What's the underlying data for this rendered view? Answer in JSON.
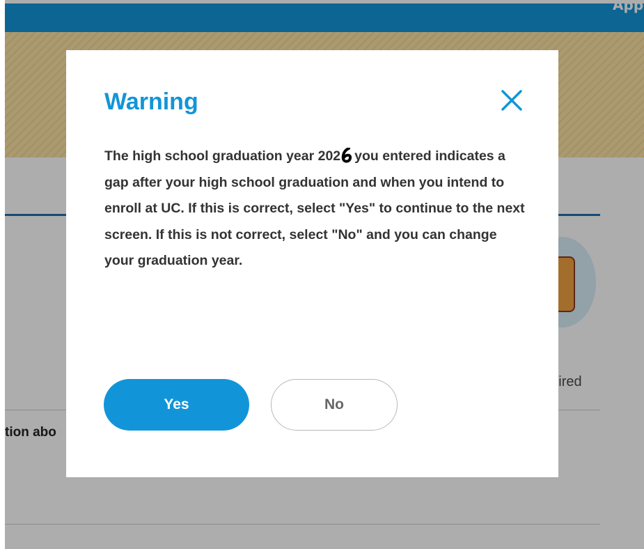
{
  "header": {
    "title_fragment": "Appl"
  },
  "background": {
    "required_text": "quired",
    "question_fragment": "tion abo"
  },
  "modal": {
    "title": "Warning",
    "close_icon": "close-icon",
    "body_before_year": "The high school graduation year 202",
    "body_after_year": "you entered indicates a gap after your high school graduation and when you intend to enroll at UC. If this is correct, select \"Yes\" to continue to the next screen. If this is not correct, select \"No\" and you can change your graduation year.",
    "yes_label": "Yes",
    "no_label": "No"
  },
  "colors": {
    "accent": "#1295d8",
    "overlay": "rgba(0,0,0,0.32)"
  }
}
